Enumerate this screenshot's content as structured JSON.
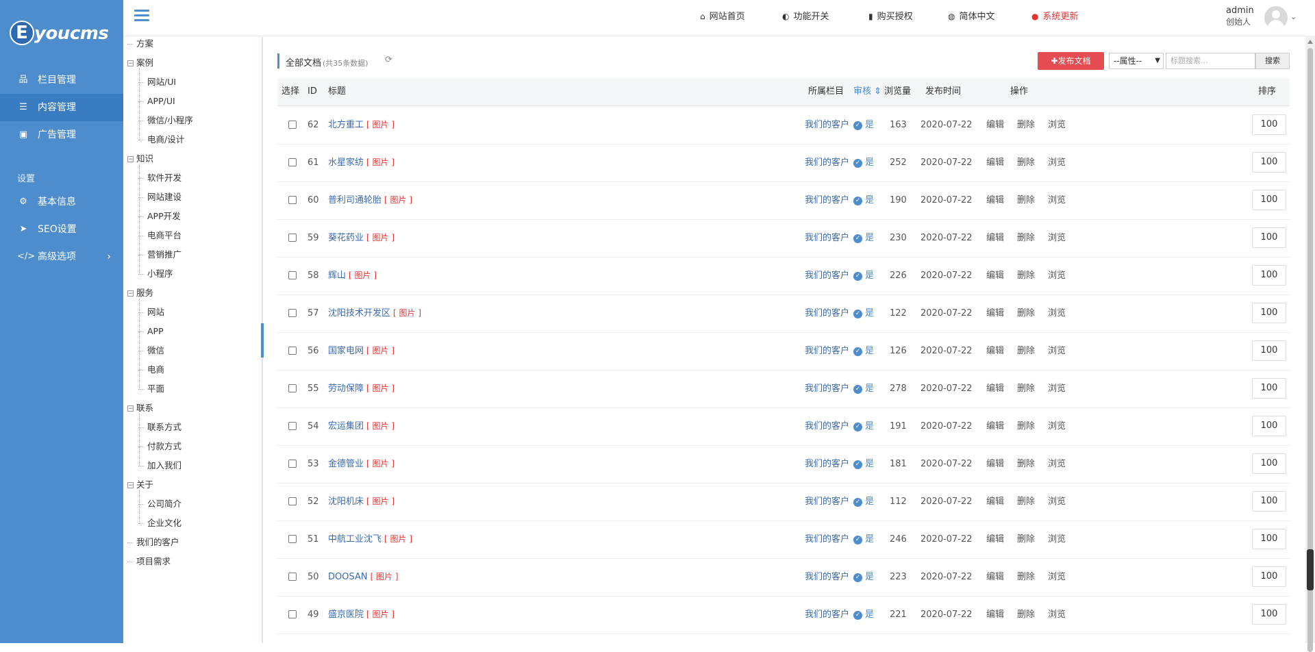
{
  "logo": {
    "e": "E",
    "text": "youcms"
  },
  "sidebar": {
    "items": [
      {
        "icon": "sitemap-icon",
        "glyph": "品",
        "label": "栏目管理"
      },
      {
        "icon": "list-icon",
        "glyph": "☰",
        "label": "内容管理"
      },
      {
        "icon": "image-icon",
        "glyph": "▣",
        "label": "广告管理"
      }
    ],
    "settings_title": "设置",
    "settings_items": [
      {
        "icon": "gear-icon",
        "glyph": "⚙",
        "label": "基本信息"
      },
      {
        "icon": "paper-plane-icon",
        "glyph": "➤",
        "label": "SEO设置"
      },
      {
        "icon": "code-icon",
        "glyph": "</>",
        "label": "高级选项",
        "arrow": "›"
      }
    ]
  },
  "tree": {
    "nodes": [
      {
        "label": "方案"
      },
      {
        "label": "案例",
        "toggle": "−",
        "children": [
          "网站/UI",
          "APP/UI",
          "微信/小程序",
          "电商/设计"
        ]
      },
      {
        "label": "知识",
        "toggle": "−",
        "children": [
          "软件开发",
          "网站建设",
          "APP开发",
          "电商平台",
          "营销推广",
          "小程序"
        ]
      },
      {
        "label": "服务",
        "toggle": "−",
        "children": [
          "网站",
          "APP",
          "微信",
          "电商",
          "平面"
        ]
      },
      {
        "label": "联系",
        "toggle": "−",
        "children": [
          "联系方式",
          "付款方式",
          "加入我们"
        ]
      },
      {
        "label": "关于",
        "toggle": "−",
        "children": [
          "公司简介",
          "企业文化"
        ]
      },
      {
        "label": "我们的客户"
      },
      {
        "label": "项目需求"
      }
    ]
  },
  "topbar": {
    "links": [
      {
        "icon": "home-icon",
        "glyph": "⌂",
        "label": "网站首页"
      },
      {
        "icon": "toggle-icon",
        "glyph": "◐",
        "label": "功能开关"
      },
      {
        "icon": "bookmark-icon",
        "glyph": "▮",
        "label": "购买授权"
      },
      {
        "icon": "globe-icon",
        "glyph": "◍",
        "label": "简体中文"
      },
      {
        "icon": "info-icon",
        "glyph": "●",
        "label": "系统更新",
        "color": "#e53333"
      }
    ],
    "user": {
      "name": "admin",
      "role": "创始人"
    }
  },
  "content": {
    "title": "全部文档",
    "count": "(共35条数据)",
    "publish_label": "发布文档",
    "publish_icon": "✚",
    "attr_select": "--属性--",
    "search_placeholder": "标题搜索...",
    "search_button": "搜索"
  },
  "table": {
    "headers": {
      "select": "选择",
      "id": "ID",
      "title": "标题",
      "category": "所属栏目",
      "audit": "审核",
      "views": "浏览量",
      "date": "发布时间",
      "ops": "操作",
      "order": "排序"
    },
    "rows": [
      {
        "id": "62",
        "title": "北方重工",
        "tag": "[ 图片 ]",
        "category": "我们的客户",
        "audit": "是",
        "views": "163",
        "date": "2020-07-22",
        "ops": [
          "编辑",
          "删除",
          "浏览"
        ],
        "order": "100"
      },
      {
        "id": "61",
        "title": "水星家纺",
        "tag": "[ 图片 ]",
        "category": "我们的客户",
        "audit": "是",
        "views": "252",
        "date": "2020-07-22",
        "ops": [
          "编辑",
          "删除",
          "浏览"
        ],
        "order": "100"
      },
      {
        "id": "60",
        "title": "普利司通轮胎",
        "tag": "[ 图片 ]",
        "category": "我们的客户",
        "audit": "是",
        "views": "190",
        "date": "2020-07-22",
        "ops": [
          "编辑",
          "删除",
          "浏览"
        ],
        "order": "100"
      },
      {
        "id": "59",
        "title": "葵花药业",
        "tag": "[ 图片 ]",
        "category": "我们的客户",
        "audit": "是",
        "views": "230",
        "date": "2020-07-22",
        "ops": [
          "编辑",
          "删除",
          "浏览"
        ],
        "order": "100"
      },
      {
        "id": "58",
        "title": "辉山",
        "tag": "[ 图片 ]",
        "category": "我们的客户",
        "audit": "是",
        "views": "226",
        "date": "2020-07-22",
        "ops": [
          "编辑",
          "删除",
          "浏览"
        ],
        "order": "100"
      },
      {
        "id": "57",
        "title": "沈阳技术开发区",
        "tag": "[ 图片 ]",
        "category": "我们的客户",
        "audit": "是",
        "views": "122",
        "date": "2020-07-22",
        "ops": [
          "编辑",
          "删除",
          "浏览"
        ],
        "order": "100"
      },
      {
        "id": "56",
        "title": "国家电网",
        "tag": "[ 图片 ]",
        "category": "我们的客户",
        "audit": "是",
        "views": "126",
        "date": "2020-07-22",
        "ops": [
          "编辑",
          "删除",
          "浏览"
        ],
        "order": "100"
      },
      {
        "id": "55",
        "title": "劳动保障",
        "tag": "[ 图片 ]",
        "category": "我们的客户",
        "audit": "是",
        "views": "278",
        "date": "2020-07-22",
        "ops": [
          "编辑",
          "删除",
          "浏览"
        ],
        "order": "100"
      },
      {
        "id": "54",
        "title": "宏运集团",
        "tag": "[ 图片 ]",
        "category": "我们的客户",
        "audit": "是",
        "views": "191",
        "date": "2020-07-22",
        "ops": [
          "编辑",
          "删除",
          "浏览"
        ],
        "order": "100"
      },
      {
        "id": "53",
        "title": "金德管业",
        "tag": "[ 图片 ]",
        "category": "我们的客户",
        "audit": "是",
        "views": "181",
        "date": "2020-07-22",
        "ops": [
          "编辑",
          "删除",
          "浏览"
        ],
        "order": "100"
      },
      {
        "id": "52",
        "title": "沈阳机床",
        "tag": "[ 图片 ]",
        "category": "我们的客户",
        "audit": "是",
        "views": "112",
        "date": "2020-07-22",
        "ops": [
          "编辑",
          "删除",
          "浏览"
        ],
        "order": "100"
      },
      {
        "id": "51",
        "title": "中航工业沈飞",
        "tag": "[ 图片 ]",
        "category": "我们的客户",
        "audit": "是",
        "views": "246",
        "date": "2020-07-22",
        "ops": [
          "编辑",
          "删除",
          "浏览"
        ],
        "order": "100"
      },
      {
        "id": "50",
        "title": "DOOSAN",
        "tag": "[ 图片 ]",
        "category": "我们的客户",
        "audit": "是",
        "views": "223",
        "date": "2020-07-22",
        "ops": [
          "编辑",
          "删除",
          "浏览"
        ],
        "order": "100"
      },
      {
        "id": "49",
        "title": "盛京医院",
        "tag": "[ 图片 ]",
        "category": "我们的客户",
        "audit": "是",
        "views": "221",
        "date": "2020-07-22",
        "ops": [
          "编辑",
          "删除",
          "浏览"
        ],
        "order": "100"
      }
    ]
  },
  "colors": {
    "sidebar": "#4d8ccd",
    "sidebar_active": "#3a7cc1",
    "accent": "#4d8ccd",
    "danger": "#e54d52",
    "link": "#3a6bb0",
    "tag": "#e53333"
  }
}
